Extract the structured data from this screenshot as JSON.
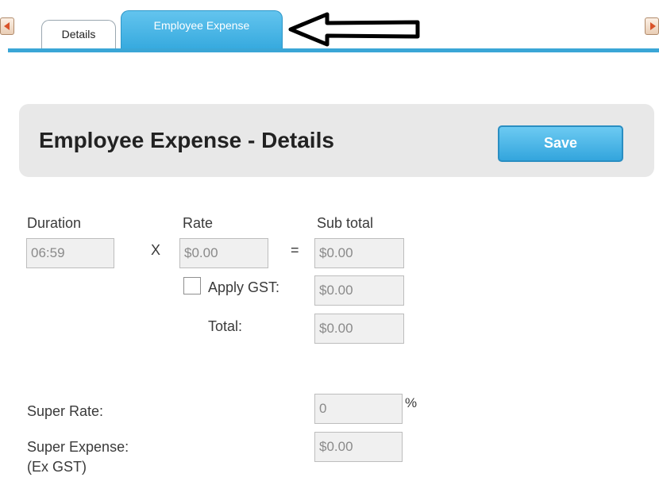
{
  "tabs": [
    {
      "label": "Details",
      "active": false
    },
    {
      "label": "Employee Expense",
      "active": true
    }
  ],
  "header": {
    "title": "Employee Expense - Details",
    "save_label": "Save"
  },
  "form": {
    "duration_label": "Duration",
    "duration_value": "06:59",
    "multiply_symbol": "X",
    "rate_label": "Rate",
    "rate_value": "$0.00",
    "equals_symbol": "=",
    "subtotal_label": "Sub total",
    "subtotal_value": "$0.00",
    "apply_gst_label": "Apply GST:",
    "apply_gst_checked": false,
    "gst_value": "$0.00",
    "total_label": "Total:",
    "total_value": "$0.00",
    "super_rate_label": "Super Rate:",
    "super_rate_value": "0",
    "super_rate_unit": "%",
    "super_expense_label": "Super Expense:",
    "super_expense_sublabel": "(Ex GST)",
    "super_expense_value": "$0.00"
  },
  "colors": {
    "accent": "#3aa6d6",
    "panel": "#e8e8e8"
  },
  "icons": {
    "scroll_left": "scroll-left-arrow-icon",
    "scroll_right": "scroll-right-arrow-icon",
    "annotation": "annotation-arrow-icon"
  }
}
